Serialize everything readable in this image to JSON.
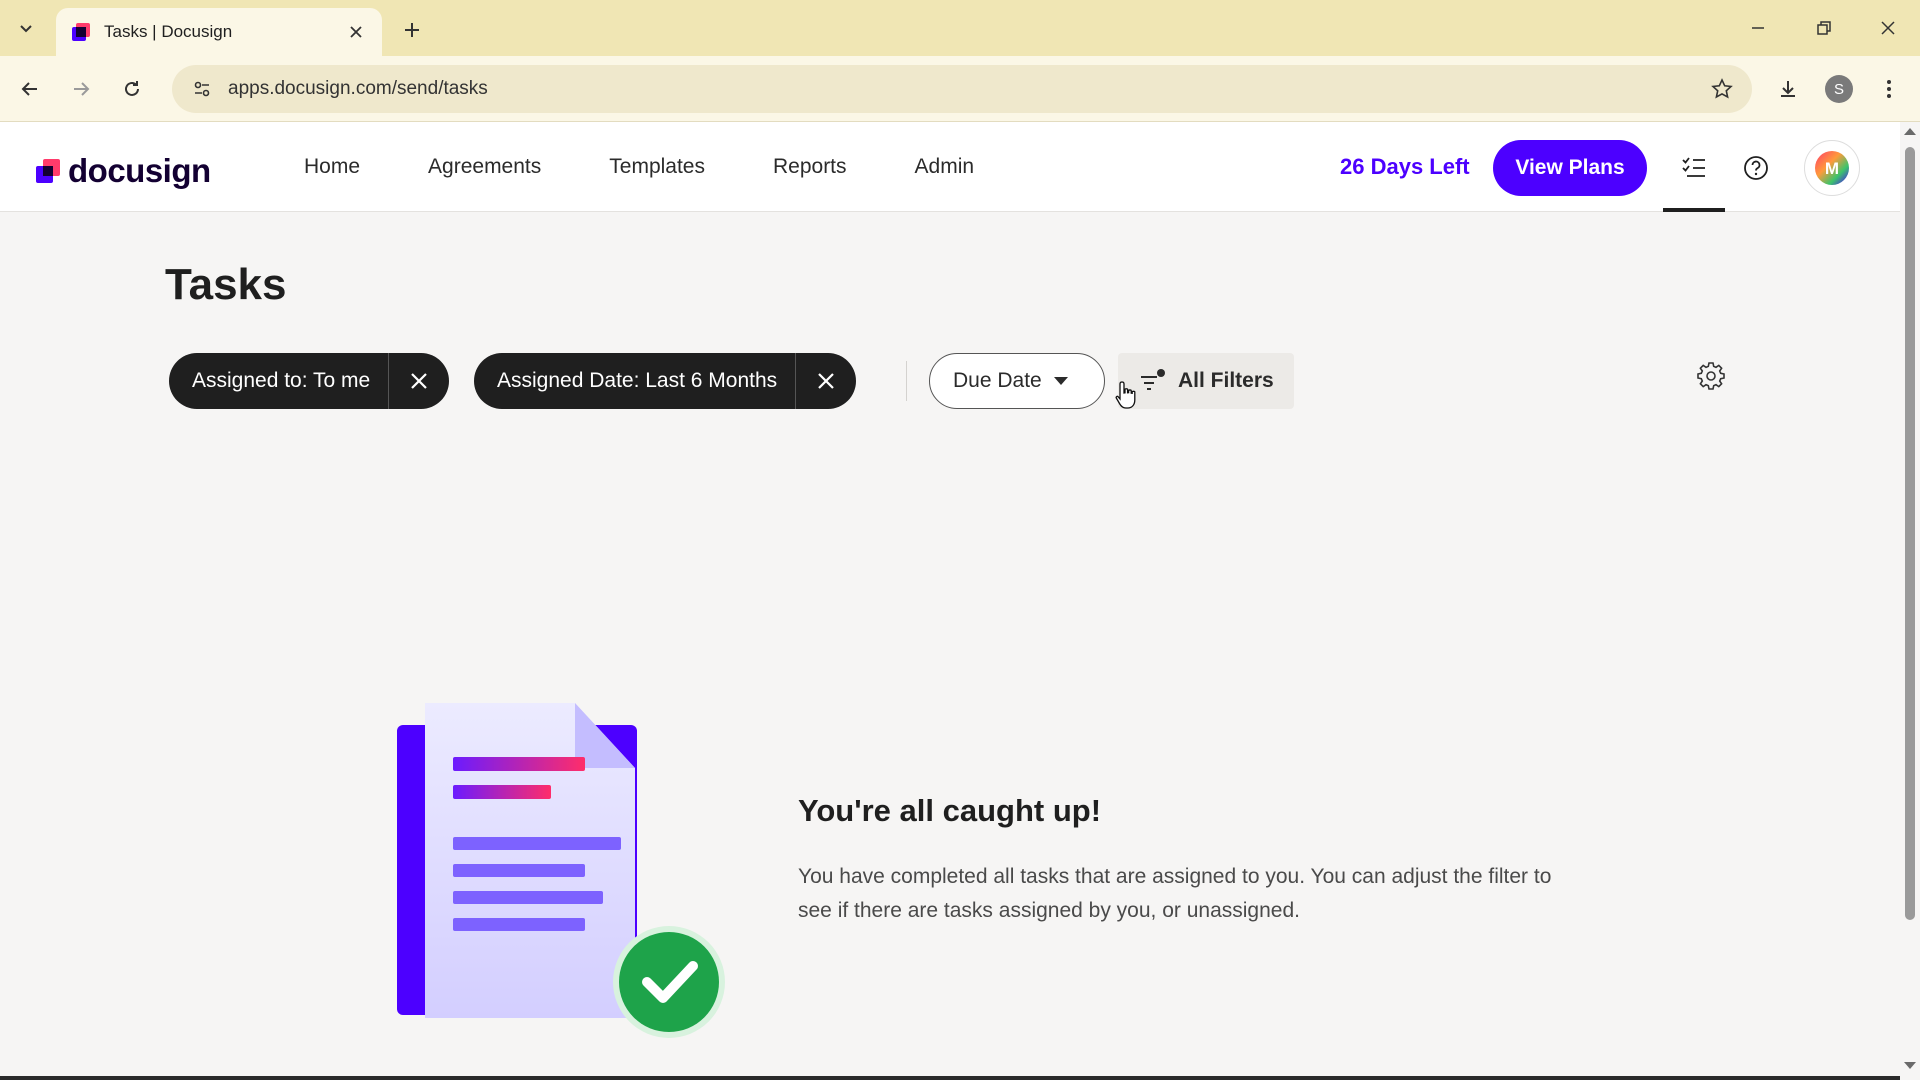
{
  "browser": {
    "tab_title": "Tasks | Docusign",
    "url": "apps.docusign.com/send/tasks",
    "profile_initial": "S"
  },
  "header": {
    "logo_text": "docusign",
    "nav": [
      "Home",
      "Agreements",
      "Templates",
      "Reports",
      "Admin"
    ],
    "trial_text": "26 Days Left",
    "view_plans_label": "View Plans",
    "avatar_initial": "M"
  },
  "page": {
    "title": "Tasks",
    "filters": [
      {
        "label": "Assigned to: To me"
      },
      {
        "label": "Assigned Date: Last 6 Months"
      }
    ],
    "sort_label": "Due Date",
    "all_filters_label": "All Filters"
  },
  "empty_state": {
    "title": "You're all caught up!",
    "body": "You have completed all tasks that are assigned to you. You can adjust the filter to see if there are tasks assigned by you, or unassigned."
  },
  "colors": {
    "brand": "#4c00ff",
    "logo_accent": "#ff3b6b",
    "success": "#1ea34a",
    "tabstrip": "#f0e6b4"
  }
}
